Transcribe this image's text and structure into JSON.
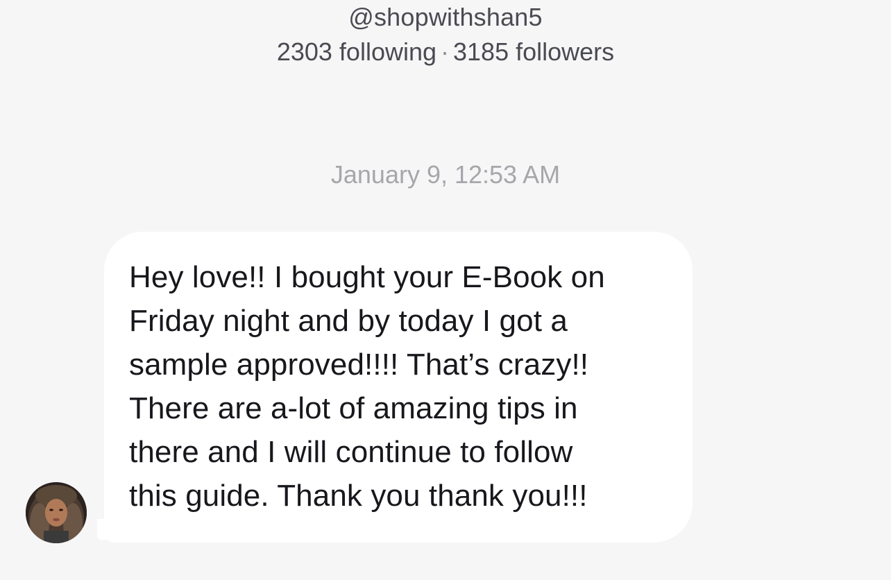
{
  "profile": {
    "username": "@shopwithshan5",
    "following": "2303 following",
    "separator": "·",
    "followers": "3185 followers"
  },
  "conversation": {
    "timestamp": "January 9, 12:53 AM",
    "messages": [
      {
        "sender": "received",
        "text": "Hey love!! I bought your E-Book on\nFriday night and by today I got a\nsample approved!!!! That’s crazy!!\nThere are a-lot of amazing tips in\nthere and I will continue to follow\nthis guide. Thank you thank you!!!"
      }
    ]
  },
  "colors": {
    "background": "#f6f6f6",
    "bubble": "#ffffff",
    "header_text": "#4a4a52",
    "timestamp_text": "#a6a6ab",
    "message_text": "#17171c"
  }
}
